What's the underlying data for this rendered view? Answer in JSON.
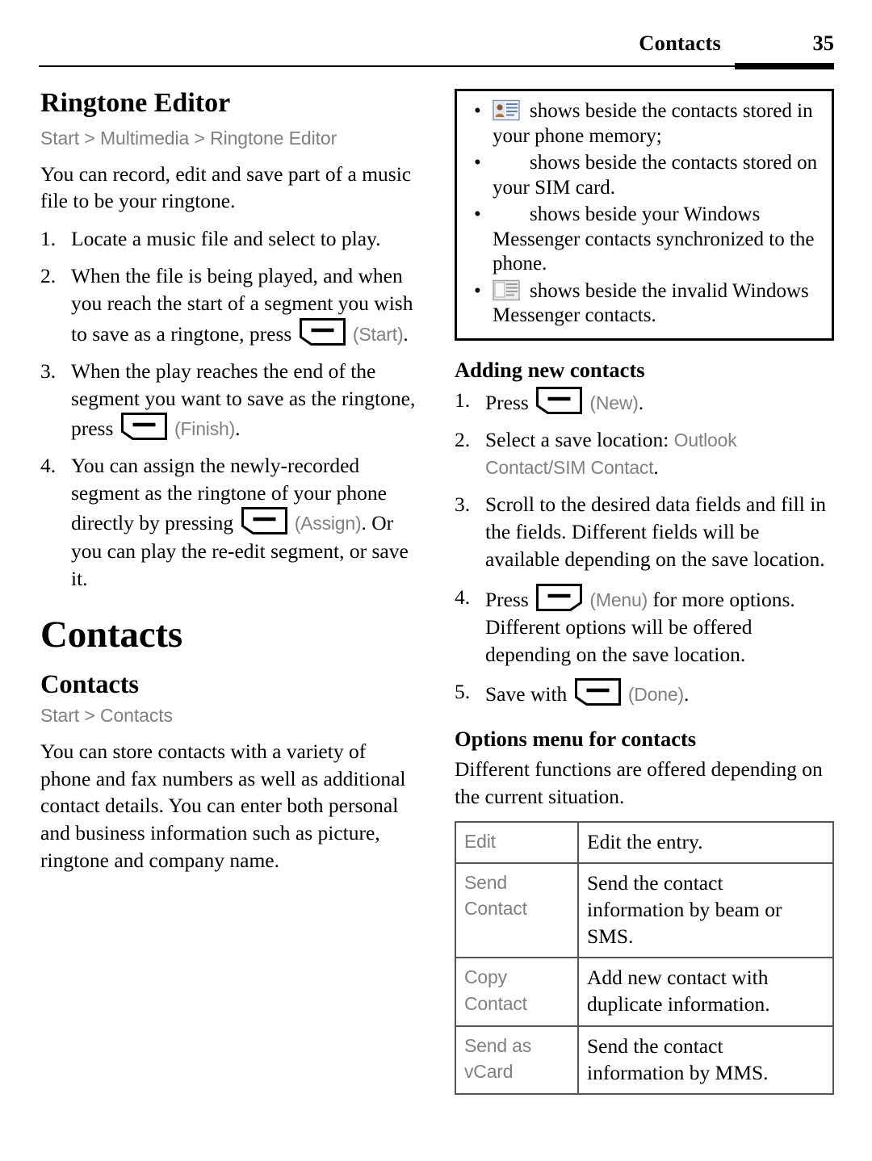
{
  "header": {
    "title": "Contacts",
    "page_number": "35"
  },
  "left_column": {
    "ringtone_editor": {
      "heading": "Ringtone Editor",
      "breadcrumb": "Start > Multimedia > Ringtone Editor",
      "intro": "You can record, edit and save part of a music file to be your ringtone.",
      "steps": [
        {
          "num": "1.",
          "parts": [
            {
              "type": "text",
              "value": "Locate a music file and select to play."
            }
          ]
        },
        {
          "num": "2.",
          "parts": [
            {
              "type": "text",
              "value": "When the file is being played, and when you reach the start of a segment you wish to save as a ringtone, press "
            },
            {
              "type": "softkey",
              "side": "left"
            },
            {
              "type": "ui",
              "value": " (Start)"
            },
            {
              "type": "text",
              "value": "."
            }
          ]
        },
        {
          "num": "3.",
          "parts": [
            {
              "type": "text",
              "value": "When the play reaches the end of the segment you want to save as the ringtone, press "
            },
            {
              "type": "softkey",
              "side": "left"
            },
            {
              "type": "ui",
              "value": " (Finish)"
            },
            {
              "type": "text",
              "value": "."
            }
          ]
        },
        {
          "num": "4.",
          "parts": [
            {
              "type": "text",
              "value": "You can assign the newly-recorded segment as the ringtone of your phone directly by pressing "
            },
            {
              "type": "softkey",
              "side": "left"
            },
            {
              "type": "ui",
              "value": " (Assign)"
            },
            {
              "type": "text",
              "value": ". Or you can play the re-edit segment, or save it."
            }
          ]
        }
      ]
    },
    "contacts_chapter": "Contacts",
    "contacts_section": {
      "heading": "Contacts",
      "breadcrumb": "Start > Contacts",
      "body": "You can store contacts with a variety of phone and fax numbers as well as additional contact details. You can enter both personal and business information such as picture, ringtone and company name."
    }
  },
  "right_column": {
    "note_box": {
      "bullets": [
        {
          "icon": "contact-card-icon",
          "icon_visible": true,
          "text": "shows beside the contacts stored in your phone memory;"
        },
        {
          "icon": "sim-contact-icon",
          "icon_visible": false,
          "text": "shows beside the contacts stored on your SIM card."
        },
        {
          "icon": "messenger-contact-icon",
          "icon_visible": false,
          "text": "shows beside your Windows Messenger contacts synchronized to the phone."
        },
        {
          "icon": "invalid-messenger-contact-icon",
          "icon_visible": true,
          "text": "shows beside the invalid Windows Messenger contacts."
        }
      ]
    },
    "adding_new_contacts": {
      "heading": "Adding new contacts",
      "steps": [
        {
          "num": "1.",
          "parts": [
            {
              "type": "text",
              "value": "Press "
            },
            {
              "type": "softkey",
              "side": "left"
            },
            {
              "type": "ui",
              "value": " (New)"
            },
            {
              "type": "text",
              "value": "."
            }
          ]
        },
        {
          "num": "2.",
          "parts": [
            {
              "type": "text",
              "value": "Select a save location: "
            },
            {
              "type": "ui",
              "value": "Outlook Contact/SIM Contact"
            },
            {
              "type": "text",
              "value": "."
            }
          ]
        },
        {
          "num": "3.",
          "parts": [
            {
              "type": "text",
              "value": "Scroll to the desired data fields and fill in the fields. Different fields will be available depending on the save location."
            }
          ]
        },
        {
          "num": "4.",
          "parts": [
            {
              "type": "text",
              "value": "Press "
            },
            {
              "type": "softkey",
              "side": "right"
            },
            {
              "type": "ui",
              "value": " (Menu)"
            },
            {
              "type": "text",
              "value": " for more options. Different options will be offered depending on the save location."
            }
          ]
        },
        {
          "num": "5.",
          "parts": [
            {
              "type": "text",
              "value": "Save with "
            },
            {
              "type": "softkey",
              "side": "left"
            },
            {
              "type": "ui",
              "value": " (Done)"
            },
            {
              "type": "text",
              "value": "."
            }
          ]
        }
      ]
    },
    "options_menu": {
      "heading": "Options menu for contacts",
      "intro": "Different functions are offered depending on the current situation.",
      "rows": [
        {
          "option": "Edit",
          "description": "Edit the entry."
        },
        {
          "option": "Send Contact",
          "description": "Send the contact information by beam or SMS."
        },
        {
          "option": "Copy Contact",
          "description": "Add new contact with duplicate information."
        },
        {
          "option": "Send as vCard",
          "description": "Send the contact information by MMS."
        }
      ]
    }
  },
  "colors": {
    "ui_gray": "#808080",
    "ink": "#000000",
    "table_border": "#555555"
  }
}
